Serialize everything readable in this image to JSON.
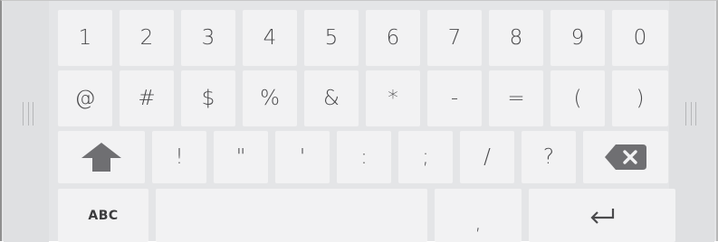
{
  "keyboard": {
    "rows": [
      [
        "1",
        "2",
        "3",
        "4",
        "5",
        "6",
        "7",
        "8",
        "9",
        "0"
      ],
      [
        "@",
        "#",
        "$",
        "%",
        "&",
        "*",
        "-",
        "=",
        "(",
        ")"
      ],
      [
        "!",
        "\"",
        "'",
        ":",
        ";",
        "/",
        "?"
      ]
    ],
    "mode_switch_label": "ABC",
    "comma_label": ",",
    "icons": {
      "shift": "arrow-up-icon",
      "backspace": "backspace-icon",
      "enter": "enter-icon",
      "grip": "drag-handle-icon"
    },
    "colors": {
      "background": "#e4e5e7",
      "key": "#f2f2f3",
      "key_text": "#4a4a4c",
      "icon": "#6f6f72"
    }
  }
}
